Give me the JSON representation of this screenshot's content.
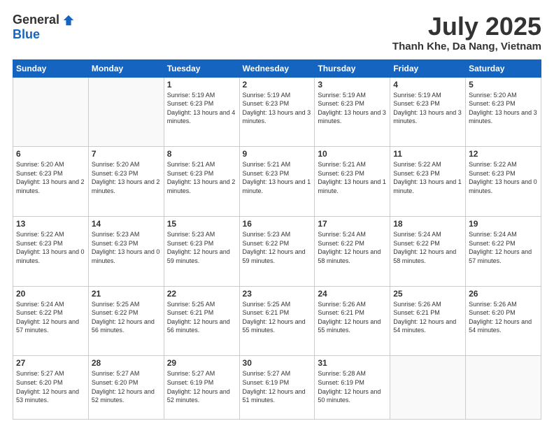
{
  "logo": {
    "general": "General",
    "blue": "Blue"
  },
  "header": {
    "month": "July 2025",
    "location": "Thanh Khe, Da Nang, Vietnam"
  },
  "weekdays": [
    "Sunday",
    "Monday",
    "Tuesday",
    "Wednesday",
    "Thursday",
    "Friday",
    "Saturday"
  ],
  "weeks": [
    [
      {
        "day": "",
        "info": ""
      },
      {
        "day": "",
        "info": ""
      },
      {
        "day": "1",
        "info": "Sunrise: 5:19 AM\nSunset: 6:23 PM\nDaylight: 13 hours and 4 minutes."
      },
      {
        "day": "2",
        "info": "Sunrise: 5:19 AM\nSunset: 6:23 PM\nDaylight: 13 hours and 3 minutes."
      },
      {
        "day": "3",
        "info": "Sunrise: 5:19 AM\nSunset: 6:23 PM\nDaylight: 13 hours and 3 minutes."
      },
      {
        "day": "4",
        "info": "Sunrise: 5:19 AM\nSunset: 6:23 PM\nDaylight: 13 hours and 3 minutes."
      },
      {
        "day": "5",
        "info": "Sunrise: 5:20 AM\nSunset: 6:23 PM\nDaylight: 13 hours and 3 minutes."
      }
    ],
    [
      {
        "day": "6",
        "info": "Sunrise: 5:20 AM\nSunset: 6:23 PM\nDaylight: 13 hours and 2 minutes."
      },
      {
        "day": "7",
        "info": "Sunrise: 5:20 AM\nSunset: 6:23 PM\nDaylight: 13 hours and 2 minutes."
      },
      {
        "day": "8",
        "info": "Sunrise: 5:21 AM\nSunset: 6:23 PM\nDaylight: 13 hours and 2 minutes."
      },
      {
        "day": "9",
        "info": "Sunrise: 5:21 AM\nSunset: 6:23 PM\nDaylight: 13 hours and 1 minute."
      },
      {
        "day": "10",
        "info": "Sunrise: 5:21 AM\nSunset: 6:23 PM\nDaylight: 13 hours and 1 minute."
      },
      {
        "day": "11",
        "info": "Sunrise: 5:22 AM\nSunset: 6:23 PM\nDaylight: 13 hours and 1 minute."
      },
      {
        "day": "12",
        "info": "Sunrise: 5:22 AM\nSunset: 6:23 PM\nDaylight: 13 hours and 0 minutes."
      }
    ],
    [
      {
        "day": "13",
        "info": "Sunrise: 5:22 AM\nSunset: 6:23 PM\nDaylight: 13 hours and 0 minutes."
      },
      {
        "day": "14",
        "info": "Sunrise: 5:23 AM\nSunset: 6:23 PM\nDaylight: 13 hours and 0 minutes."
      },
      {
        "day": "15",
        "info": "Sunrise: 5:23 AM\nSunset: 6:23 PM\nDaylight: 12 hours and 59 minutes."
      },
      {
        "day": "16",
        "info": "Sunrise: 5:23 AM\nSunset: 6:22 PM\nDaylight: 12 hours and 59 minutes."
      },
      {
        "day": "17",
        "info": "Sunrise: 5:24 AM\nSunset: 6:22 PM\nDaylight: 12 hours and 58 minutes."
      },
      {
        "day": "18",
        "info": "Sunrise: 5:24 AM\nSunset: 6:22 PM\nDaylight: 12 hours and 58 minutes."
      },
      {
        "day": "19",
        "info": "Sunrise: 5:24 AM\nSunset: 6:22 PM\nDaylight: 12 hours and 57 minutes."
      }
    ],
    [
      {
        "day": "20",
        "info": "Sunrise: 5:24 AM\nSunset: 6:22 PM\nDaylight: 12 hours and 57 minutes."
      },
      {
        "day": "21",
        "info": "Sunrise: 5:25 AM\nSunset: 6:22 PM\nDaylight: 12 hours and 56 minutes."
      },
      {
        "day": "22",
        "info": "Sunrise: 5:25 AM\nSunset: 6:21 PM\nDaylight: 12 hours and 56 minutes."
      },
      {
        "day": "23",
        "info": "Sunrise: 5:25 AM\nSunset: 6:21 PM\nDaylight: 12 hours and 55 minutes."
      },
      {
        "day": "24",
        "info": "Sunrise: 5:26 AM\nSunset: 6:21 PM\nDaylight: 12 hours and 55 minutes."
      },
      {
        "day": "25",
        "info": "Sunrise: 5:26 AM\nSunset: 6:21 PM\nDaylight: 12 hours and 54 minutes."
      },
      {
        "day": "26",
        "info": "Sunrise: 5:26 AM\nSunset: 6:20 PM\nDaylight: 12 hours and 54 minutes."
      }
    ],
    [
      {
        "day": "27",
        "info": "Sunrise: 5:27 AM\nSunset: 6:20 PM\nDaylight: 12 hours and 53 minutes."
      },
      {
        "day": "28",
        "info": "Sunrise: 5:27 AM\nSunset: 6:20 PM\nDaylight: 12 hours and 52 minutes."
      },
      {
        "day": "29",
        "info": "Sunrise: 5:27 AM\nSunset: 6:19 PM\nDaylight: 12 hours and 52 minutes."
      },
      {
        "day": "30",
        "info": "Sunrise: 5:27 AM\nSunset: 6:19 PM\nDaylight: 12 hours and 51 minutes."
      },
      {
        "day": "31",
        "info": "Sunrise: 5:28 AM\nSunset: 6:19 PM\nDaylight: 12 hours and 50 minutes."
      },
      {
        "day": "",
        "info": ""
      },
      {
        "day": "",
        "info": ""
      }
    ]
  ]
}
